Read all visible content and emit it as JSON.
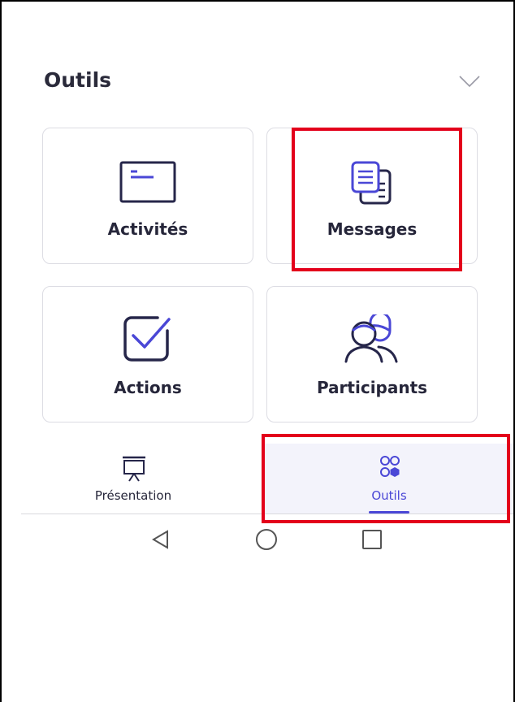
{
  "header": {
    "title": "Outils",
    "collapse_icon": "chevron-down-icon"
  },
  "tools": [
    {
      "label": "Activités",
      "icon": "activity-board-icon"
    },
    {
      "label": "Messages",
      "icon": "messages-icon"
    },
    {
      "label": "Actions",
      "icon": "checkbox-icon"
    },
    {
      "label": "Participants",
      "icon": "participants-icon"
    }
  ],
  "bottom_nav": [
    {
      "label": "Présentation",
      "icon": "presentation-icon",
      "active": false
    },
    {
      "label": "Outils",
      "icon": "tools-grid-icon",
      "active": true
    }
  ],
  "system_nav": [
    "back-icon",
    "home-icon",
    "recents-icon"
  ],
  "colors": {
    "accent": "#4a47d6",
    "icon_dark": "#26264a",
    "highlight": "#e3001b",
    "card_border": "#dcdce3"
  }
}
